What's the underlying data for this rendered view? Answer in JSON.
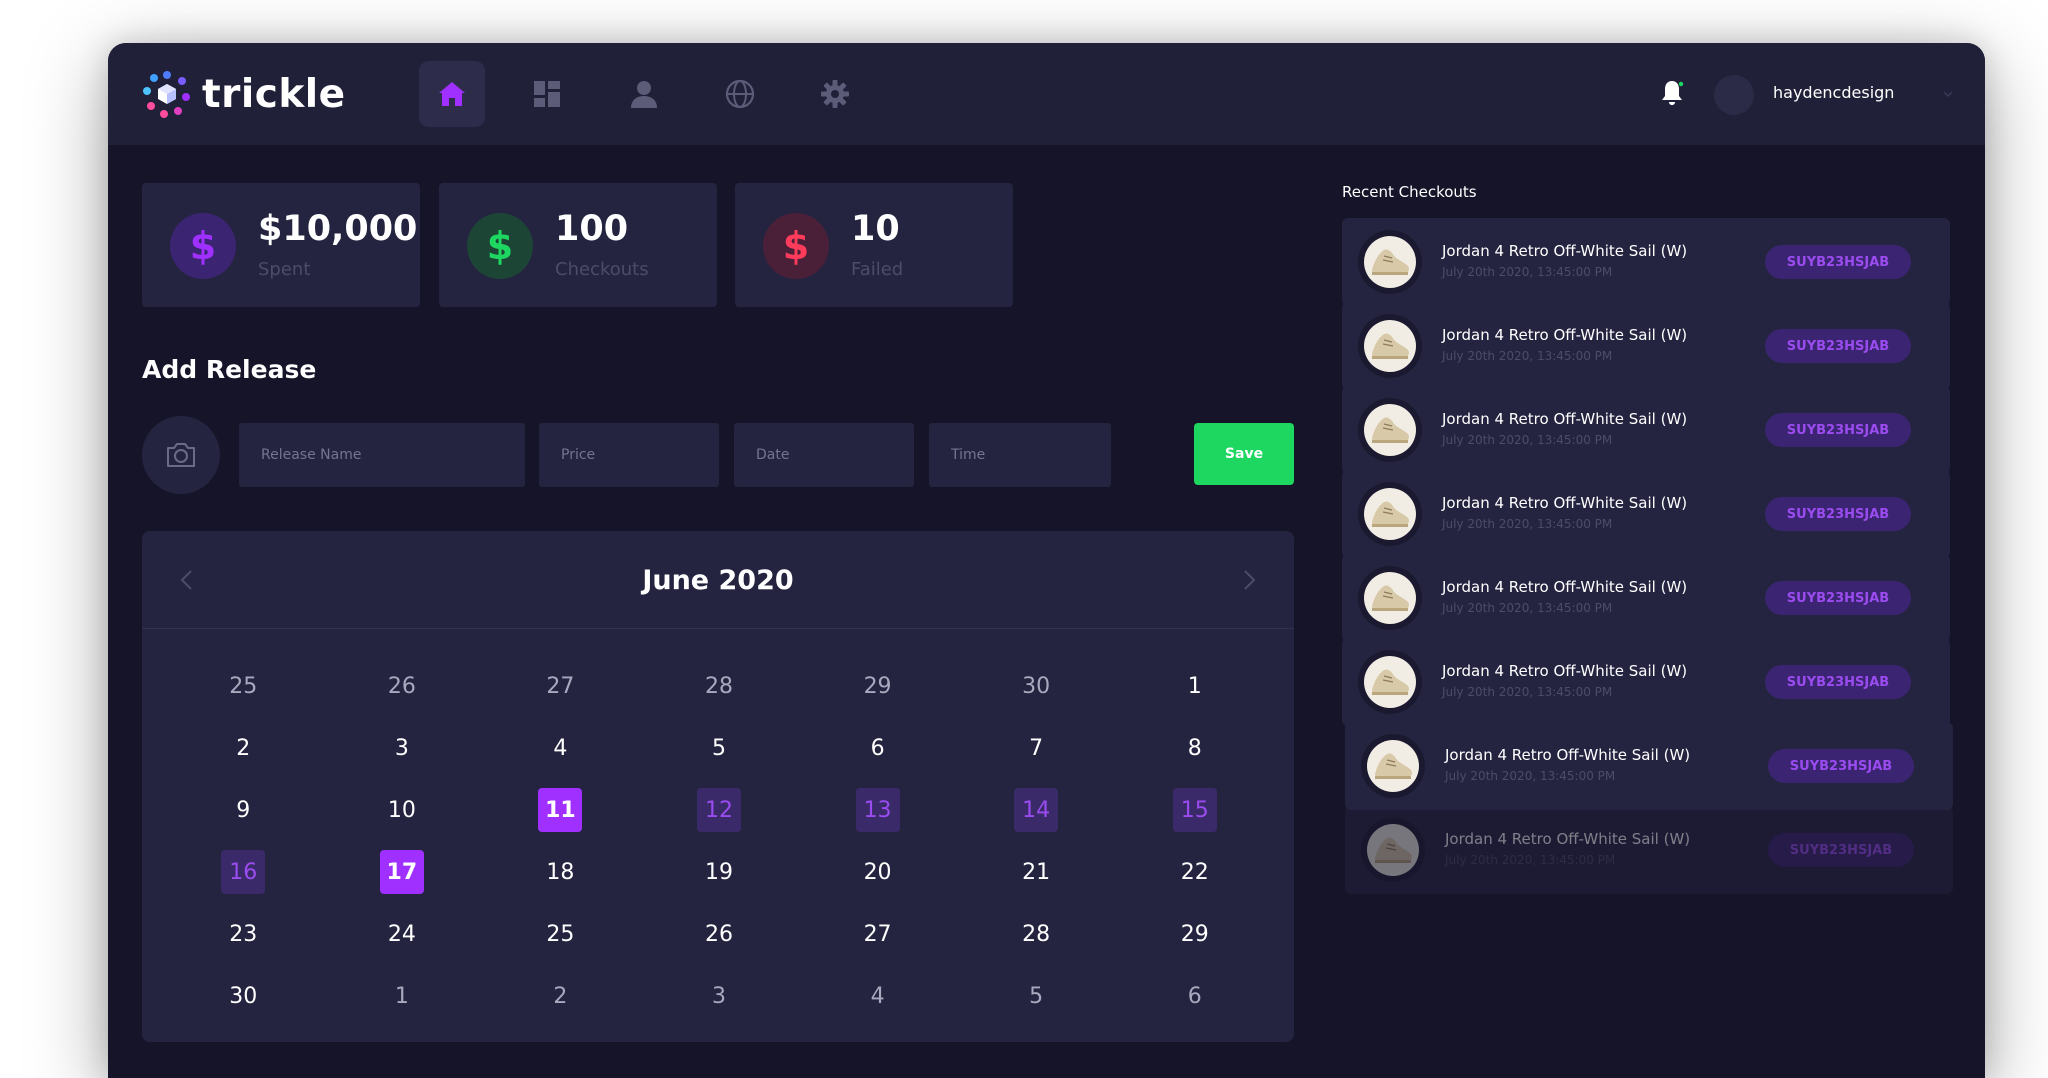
{
  "app": {
    "logo_text": "trickle",
    "username": "haydencdesign",
    "accent": "#a030ff",
    "success": "#1ed760",
    "danger": "#ff3b5c"
  },
  "nav": [
    {
      "icon": "home-icon",
      "active": true
    },
    {
      "icon": "dashboard-icon",
      "active": false
    },
    {
      "icon": "user-icon",
      "active": false
    },
    {
      "icon": "globe-icon",
      "active": false
    },
    {
      "icon": "gear-icon",
      "active": false
    }
  ],
  "stats": [
    {
      "value": "$10,000",
      "label": "Spent",
      "icon_symbol": "$",
      "color": "#a030ff"
    },
    {
      "value": "100",
      "label": "Checkouts",
      "icon_symbol": "$",
      "color": "#1ed760"
    },
    {
      "value": "10",
      "label": "Failed",
      "icon_symbol": "$",
      "color": "#ff3b5c"
    }
  ],
  "add_release": {
    "title": "Add Release",
    "release_name_placeholder": "Release Name",
    "price_placeholder": "Price",
    "date_placeholder": "Date",
    "time_placeholder": "Time",
    "save_label": "Save"
  },
  "calendar": {
    "title": "June 2020",
    "days": [
      {
        "d": "25",
        "state": "muted"
      },
      {
        "d": "26",
        "state": "muted"
      },
      {
        "d": "27",
        "state": "muted"
      },
      {
        "d": "28",
        "state": "muted"
      },
      {
        "d": "29",
        "state": "muted"
      },
      {
        "d": "30",
        "state": "muted"
      },
      {
        "d": "1",
        "state": ""
      },
      {
        "d": "2",
        "state": ""
      },
      {
        "d": "3",
        "state": ""
      },
      {
        "d": "4",
        "state": ""
      },
      {
        "d": "5",
        "state": ""
      },
      {
        "d": "6",
        "state": ""
      },
      {
        "d": "7",
        "state": ""
      },
      {
        "d": "8",
        "state": ""
      },
      {
        "d": "9",
        "state": ""
      },
      {
        "d": "10",
        "state": ""
      },
      {
        "d": "11",
        "state": "selected"
      },
      {
        "d": "12",
        "state": "range"
      },
      {
        "d": "13",
        "state": "range"
      },
      {
        "d": "14",
        "state": "range"
      },
      {
        "d": "15",
        "state": "range"
      },
      {
        "d": "16",
        "state": "range"
      },
      {
        "d": "17",
        "state": "selected"
      },
      {
        "d": "18",
        "state": ""
      },
      {
        "d": "19",
        "state": ""
      },
      {
        "d": "20",
        "state": ""
      },
      {
        "d": "21",
        "state": ""
      },
      {
        "d": "22",
        "state": ""
      },
      {
        "d": "23",
        "state": ""
      },
      {
        "d": "24",
        "state": ""
      },
      {
        "d": "25",
        "state": ""
      },
      {
        "d": "26",
        "state": ""
      },
      {
        "d": "27",
        "state": ""
      },
      {
        "d": "28",
        "state": ""
      },
      {
        "d": "29",
        "state": ""
      },
      {
        "d": "30",
        "state": ""
      },
      {
        "d": "1",
        "state": "muted"
      },
      {
        "d": "2",
        "state": "muted"
      },
      {
        "d": "3",
        "state": "muted"
      },
      {
        "d": "4",
        "state": "muted"
      },
      {
        "d": "5",
        "state": "muted"
      },
      {
        "d": "6",
        "state": "muted"
      }
    ]
  },
  "recent": {
    "title": "Recent Checkouts",
    "items": [
      {
        "name": "Jordan 4 Retro Off-White Sail (W)",
        "date": "July 20th 2020, 13:45:00 PM",
        "code": "SUYB23HSJAB"
      },
      {
        "name": "Jordan 4 Retro Off-White Sail (W)",
        "date": "July 20th 2020, 13:45:00 PM",
        "code": "SUYB23HSJAB"
      },
      {
        "name": "Jordan 4 Retro Off-White Sail (W)",
        "date": "July 20th 2020, 13:45:00 PM",
        "code": "SUYB23HSJAB"
      },
      {
        "name": "Jordan 4 Retro Off-White Sail (W)",
        "date": "July 20th 2020, 13:45:00 PM",
        "code": "SUYB23HSJAB"
      },
      {
        "name": "Jordan 4 Retro Off-White Sail (W)",
        "date": "July 20th 2020, 13:45:00 PM",
        "code": "SUYB23HSJAB"
      },
      {
        "name": "Jordan 4 Retro Off-White Sail (W)",
        "date": "July 20th 2020, 13:45:00 PM",
        "code": "SUYB23HSJAB"
      },
      {
        "name": "Jordan 4 Retro Off-White Sail (W)",
        "date": "July 20th 2020, 13:45:00 PM",
        "code": "SUYB23HSJAB"
      },
      {
        "name": "Jordan 4 Retro Off-White Sail (W)",
        "date": "July 20th 2020, 13:45:00 PM",
        "code": "SUYB23HSJAB"
      }
    ]
  }
}
